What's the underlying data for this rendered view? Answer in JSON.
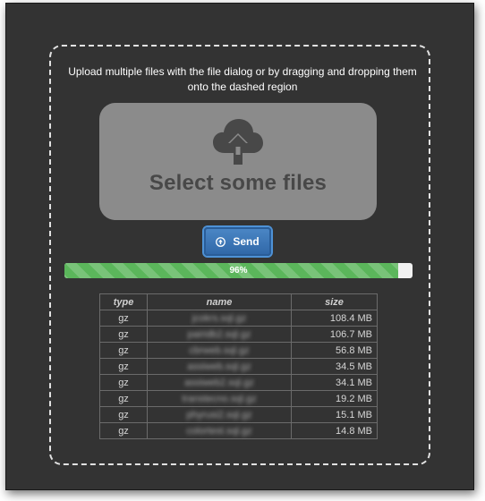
{
  "instructions": "Upload multiple files with the file dialog or by dragging and dropping them onto the dashed region",
  "select_label": "Select some files",
  "send_label": "Send",
  "progress": {
    "percent": 96,
    "label": "96%"
  },
  "icons": {
    "upload": "cloud-upload-icon",
    "send": "arrow-up-circle-icon"
  },
  "colors": {
    "background": "#333333",
    "progress": "#5bb65b",
    "button": "#3a76b8"
  },
  "table": {
    "headers": {
      "type": "type",
      "name": "name",
      "size": "size"
    },
    "rows": [
      {
        "type": "gz",
        "name": "jcokrs.sql.gz",
        "size": "108.4 MB"
      },
      {
        "type": "gz",
        "name": "pairidb2.sql.gz",
        "size": "106.7 MB"
      },
      {
        "type": "gz",
        "name": "cbrweb.sql.gz",
        "size": "56.8 MB"
      },
      {
        "type": "gz",
        "name": "assiweb.sql.gz",
        "size": "34.5 MB"
      },
      {
        "type": "gz",
        "name": "assiweb2.sql.gz",
        "size": "34.1 MB"
      },
      {
        "type": "gz",
        "name": "transtecno.sql.gz",
        "size": "19.2 MB"
      },
      {
        "type": "gz",
        "name": "phyrusi2.sql.gz",
        "size": "15.1 MB"
      },
      {
        "type": "gz",
        "name": "colortest.sql.gz",
        "size": "14.8 MB"
      }
    ]
  }
}
